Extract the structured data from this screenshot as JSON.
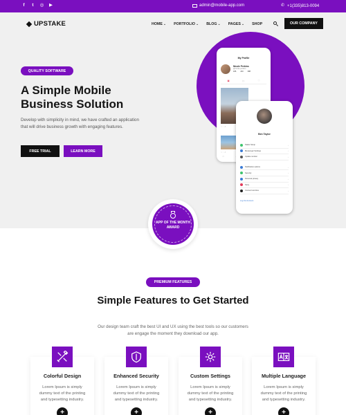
{
  "topbar": {
    "social_icons": [
      "facebook-icon",
      "twitter-icon",
      "instagram-icon",
      "youtube-icon"
    ],
    "email": "admin@mobile-app.com",
    "phone": "+1(335)813-0094"
  },
  "header": {
    "logo": "UPSTAKE",
    "nav": [
      {
        "label": "HOME",
        "chevron": "⌄"
      },
      {
        "label": "PORTFOLIO",
        "chevron": "⌄"
      },
      {
        "label": "BLOG",
        "chevron": "⌄"
      },
      {
        "label": "PAGES",
        "chevron": "⌄"
      },
      {
        "label": "SHOP",
        "chevron": ""
      }
    ],
    "cta": "OUR COMPANY"
  },
  "hero": {
    "badge": "QUALITY SOFTWARE",
    "title": "A Simple Mobile Business Solution",
    "description": "Develop with simplicity in mind, we have crafted an application that will drive business growth with engaging features.",
    "btn_trial": "FREE TRIAL",
    "btn_more": "LEARN MORE"
  },
  "phone1": {
    "title": "My Profile",
    "name": "Nicole Perkins",
    "subtitle": "@nicole.perkins",
    "stats": [
      "186",
      "240",
      "388"
    ]
  },
  "phone2": {
    "name": "Ben Taylor",
    "rows": [
      "Status Setup",
      "Messenger Settings",
      "Update number",
      "Notification options",
      "Security",
      "Personal privacy",
      "Story",
      "Connect services"
    ],
    "logout": "Log Out Account"
  },
  "award": {
    "text": "APP OF THE MONTH AWARD"
  },
  "features": {
    "badge": "PREMIUM FEATURES",
    "title": "Simple Features to Get Started",
    "description": "Our design team craft the best UI and UX using the best tools so our customers are engage the moment they download our app.",
    "cards": [
      {
        "title": "Colorful Design",
        "desc": "Lorem Ipsum is simply dummy text of the printing and typesetting industry.",
        "icon": "design-tools-icon"
      },
      {
        "title": "Enhanced Security",
        "desc": "Lorem Ipsum is simply dummy text of the printing and typesetting industry.",
        "icon": "shield-icon"
      },
      {
        "title": "Custom Settings",
        "desc": "Lorem Ipsum is simply dummy text of the printing and typesetting industry.",
        "icon": "gear-icon"
      },
      {
        "title": "Multiple Language",
        "desc": "Lorem Ipsum is simply dummy text of the printing and typesetting industry.",
        "icon": "translate-icon"
      }
    ]
  },
  "colors": {
    "accent": "#7a0fbf",
    "dark": "#111111",
    "hero_bg": "#f0f0f0"
  }
}
